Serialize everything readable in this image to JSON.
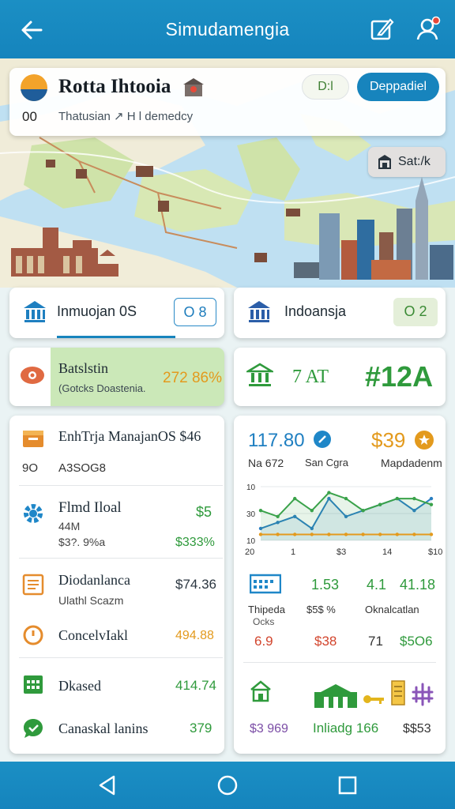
{
  "app_bar": {
    "title": "Simudamengia"
  },
  "top_card": {
    "title": "Rotta Ihtooia",
    "prefix": "00",
    "subtitle": "Thatusian ↗ H l demedcy",
    "pill_outline": "D:l",
    "pill_button": "Deppadiel"
  },
  "map_button": {
    "label": "Sat:/k"
  },
  "tiles": {
    "left": {
      "label": "Inmuojan 0S",
      "badge": "O 8"
    },
    "right": {
      "label": "Indoansja",
      "badge": "O 2"
    },
    "promo": {
      "title": "Batslstin",
      "subtitle": "(Gotcks Doastenia.",
      "value": "272 86%"
    },
    "summary": {
      "label": "7 AT",
      "value": "#12A"
    }
  },
  "left_list": {
    "header": {
      "title": "EnhTrja ManajanOS $46",
      "value_a": "9O",
      "value_b": "A3SOG8"
    },
    "items": [
      {
        "title": "Flmd Iloal",
        "sub1": "44M",
        "sub2": "$3?. 9%a",
        "value": "$5",
        "value2": "$333%"
      },
      {
        "title": "Diodanlanca",
        "sub1": "Ulathl Scazm",
        "value": "$74.36"
      },
      {
        "title": "ConcelvIakl",
        "value": "494.88"
      },
      {
        "title": "Dkased",
        "value": "414.74"
      },
      {
        "title": "Canaskal lanins",
        "value": "379"
      }
    ]
  },
  "right_panel": {
    "stats": {
      "v1": "117.80",
      "v2": "$39",
      "l1": "Na 672",
      "l2": "San Cgra",
      "l3": "Mapdadenm"
    },
    "chart_data": {
      "type": "line",
      "y_ticks": [
        "10",
        "30",
        "10"
      ],
      "x_ticks": [
        "20",
        "1",
        "$3",
        "14",
        "$10"
      ],
      "series": [
        {
          "color": "#2a7fc1",
          "values": [
            2,
            3,
            4,
            2,
            7,
            4,
            5,
            6,
            7,
            5,
            7
          ]
        },
        {
          "color": "#3aa24a",
          "values": [
            5,
            4,
            7,
            5,
            8,
            7,
            5,
            6,
            7,
            7,
            6
          ]
        },
        {
          "color": "#e39a1d",
          "values": [
            1,
            1,
            1,
            1,
            1,
            1,
            1,
            1,
            1,
            1,
            1
          ]
        }
      ]
    },
    "mid": {
      "a": "1.53",
      "b": "4.1",
      "c": "41.18",
      "l1": "Thipeda",
      "l1b": "Ocks",
      "l2": "$5$ %",
      "l3": "Oknalcatlan",
      "v1": "6.9",
      "v2": "$38",
      "v3": "71",
      "v4": "$5O6"
    },
    "bottom": {
      "a": "$3 969",
      "b": "Inliadg 166",
      "c": "$$53"
    }
  },
  "colors": {
    "primary": "#1784bd",
    "green": "#2f9a3c",
    "orange": "#e39a1d",
    "red": "#d2452d"
  }
}
